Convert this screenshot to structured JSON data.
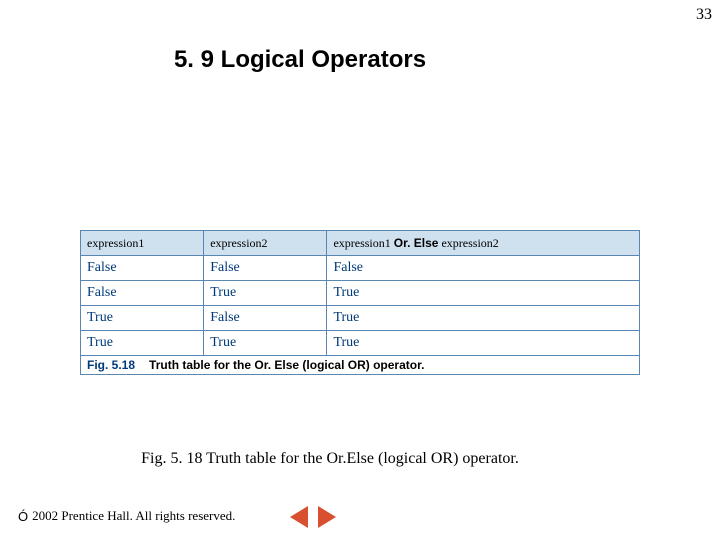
{
  "page_number": "33",
  "title": "5. 9 Logical Operators",
  "table": {
    "headers": {
      "c1": "expression1",
      "c2": "expression2",
      "c3_pre": "expression1 ",
      "c3_op": "Or. Else",
      "c3_post": " expression2"
    },
    "rows": [
      {
        "c1": "False",
        "c2": "False",
        "c3": "False"
      },
      {
        "c1": "False",
        "c2": "True",
        "c3": "True"
      },
      {
        "c1": "True",
        "c2": "False",
        "c3": "True"
      },
      {
        "c1": "True",
        "c2": "True",
        "c3": "True"
      }
    ],
    "caption_bar": {
      "fig_num": "Fig. 5.18",
      "text_pre": "Truth table for the ",
      "op": "Or. Else",
      "text_mid": " (logical ",
      "op2": "OR",
      "text_post": ") operator."
    }
  },
  "bottom_caption": "Fig. 5. 18   Truth table for the Or.Else (logical OR) operator.",
  "footer": {
    "symbol": "Ó",
    "text": " 2002 Prentice Hall. All rights reserved."
  }
}
